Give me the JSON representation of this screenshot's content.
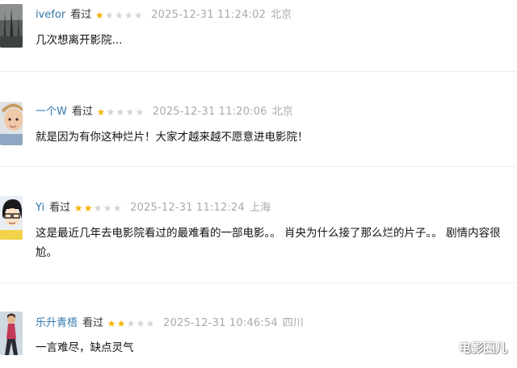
{
  "watermark": "电影圈儿",
  "colors": {
    "username": "#3377aa",
    "star_on": "#f4b400",
    "star_off": "#d4d4d4",
    "meta": "#aaaaaa"
  },
  "comments": [
    {
      "user": "ivefor",
      "action": "看过",
      "rating": 1,
      "max_rating": 5,
      "time": "2025-12-31 11:24:02",
      "location": "北京",
      "text": "几次想离开影院..."
    },
    {
      "user": "一个W",
      "action": "看过",
      "rating": 1,
      "max_rating": 5,
      "time": "2025-12-31 11:20:06",
      "location": "北京",
      "text": "就是因为有你这种烂片！大家才越来越不愿意进电影院！"
    },
    {
      "user": "Yi",
      "action": "看过",
      "rating": 2,
      "max_rating": 5,
      "time": "2025-12-31 11:12:24",
      "location": "上海",
      "text": "这是最近几年去电影院看过的最难看的一部电影。。 肖央为什么接了那么烂的片子。。 剧情内容很尬。"
    },
    {
      "user": "乐升青梧",
      "action": "看过",
      "rating": 2,
      "max_rating": 5,
      "time": "2025-12-31 10:46:54",
      "location": "四川",
      "text": "一言难尽，缺点灵气"
    }
  ]
}
